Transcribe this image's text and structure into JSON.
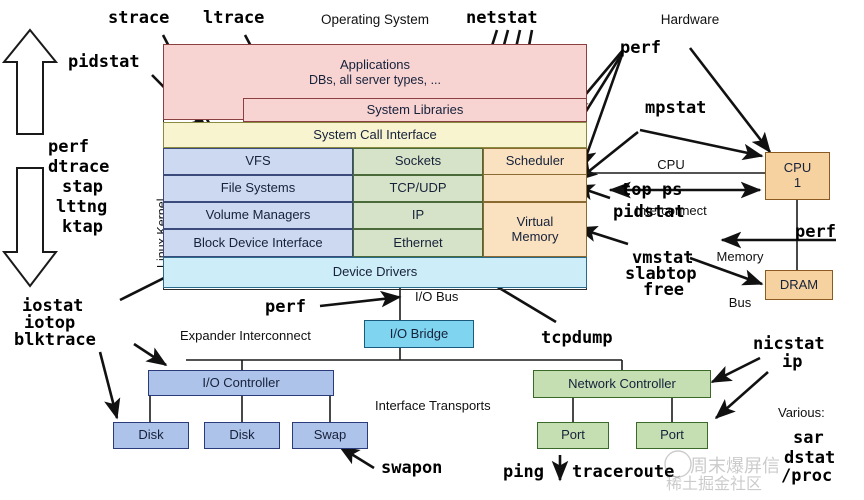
{
  "title_labels": {
    "operating_system": "Operating System",
    "hardware": "Hardware",
    "linux_kernel": "Linux Kernel"
  },
  "os_stack": {
    "applications_line1": "Applications",
    "applications_line2": "DBs, all server types, ...",
    "system_libraries": "System Libraries",
    "system_call_interface": "System Call Interface",
    "left_column": [
      "VFS",
      "File Systems",
      "Volume Managers",
      "Block Device Interface"
    ],
    "middle_column": [
      "Sockets",
      "TCP/UDP",
      "IP",
      "Ethernet"
    ],
    "right_column": [
      "Scheduler",
      "Virtual\nMemory"
    ],
    "device_drivers": "Device Drivers"
  },
  "hardware": {
    "cpu_label_line1": "CPU",
    "cpu_label_line2": "1",
    "dram": "DRAM",
    "cpu_interconnect_line1": "CPU",
    "cpu_interconnect_line2": "Interconnect",
    "memory_bus_line1": "Memory",
    "memory_bus_line2": "Bus"
  },
  "io_section": {
    "io_bus": "I/O Bus",
    "io_bridge": "I/O Bridge",
    "expander_interconnect": "Expander Interconnect",
    "io_controller": "I/O Controller",
    "interface_transports": "Interface Transports",
    "disk_1": "Disk",
    "disk_2": "Disk",
    "swap": "Swap"
  },
  "network_section": {
    "network_controller": "Network Controller",
    "port_1": "Port",
    "port_2": "Port"
  },
  "tools": {
    "strace": "strace",
    "ltrace": "ltrace",
    "netstat": "netstat",
    "pidstat_top_left": "pidstat",
    "perf_hw": "perf",
    "mpstat": "mpstat",
    "perf_left": "perf",
    "dtrace": "dtrace",
    "stap": "stap",
    "lttng": "lttng",
    "ktap": "ktap",
    "top_ps": "top ps",
    "pidstat_right": "pidstat",
    "vmstat": "vmstat",
    "slabtop": "slabtop",
    "free": "free",
    "perf_mem": "perf",
    "iostat": "iostat",
    "iotop": "iotop",
    "blktrace": "blktrace",
    "perf_iobus": "perf",
    "tcpdump": "tcpdump",
    "nicstat": "nicstat",
    "ip": "ip",
    "swapon": "swapon",
    "ping": "ping",
    "traceroute": "traceroute",
    "various_header": "Various:",
    "sar": "sar",
    "dstat": "dstat",
    "proc": "/proc"
  },
  "watermark": {
    "line1": "周末爆屏信",
    "line2": "稀土掘金社区"
  },
  "colors": {
    "applications": "#f7d3d2",
    "syscall": "#f7f4cf",
    "fs_stack": "#ccd9f0",
    "net_stack": "#d7e3c8",
    "sched_vm": "#fae2c0",
    "device_drivers": "#cdeef8",
    "io_bridge": "#7fd4f0",
    "io_boxes": "#aec3ea",
    "net_boxes": "#c5dfb3",
    "hw_boxes": "#f6d2a0"
  }
}
